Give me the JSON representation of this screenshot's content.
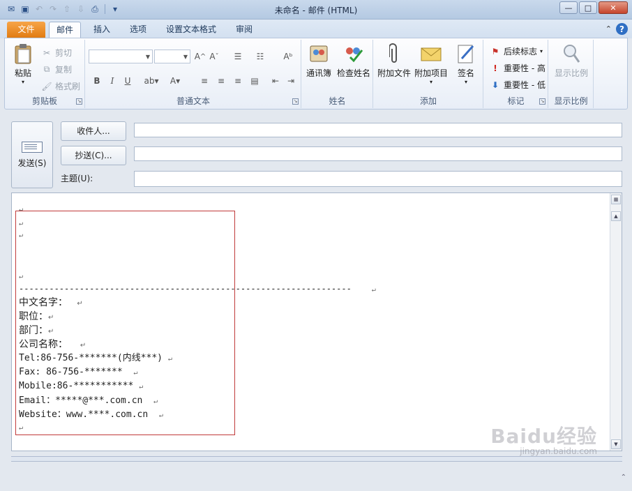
{
  "window": {
    "title": "未命名 - 邮件 (HTML)",
    "minimize": "—",
    "maximize": "□",
    "close": "✕"
  },
  "tabs": {
    "file": "文件",
    "items": [
      "邮件",
      "插入",
      "选项",
      "设置文本格式",
      "审阅"
    ],
    "active_index": 0
  },
  "ribbon": {
    "clipboard": {
      "label": "剪贴板",
      "paste": "粘贴",
      "cut": "剪切",
      "copy": "复制",
      "format_painter": "格式刷"
    },
    "basic_text": {
      "label": "普通文本",
      "bold": "B",
      "italic": "I",
      "underline": "U"
    },
    "names": {
      "label": "姓名",
      "address_book": "通讯簿",
      "check_names": "检查姓名"
    },
    "include": {
      "label": "添加",
      "attach_file": "附加文件",
      "attach_item": "附加项目",
      "signature": "签名"
    },
    "tags": {
      "label": "标记",
      "follow_up": "后续标志",
      "high_importance": "重要性 - 高",
      "low_importance": "重要性 - 低"
    },
    "zoom": {
      "label": "显示比例",
      "zoom": "显示比例"
    }
  },
  "compose": {
    "send": "发送(S)",
    "to": "收件人...",
    "cc": "抄送(C)...",
    "subject": "主题(U):",
    "to_value": "",
    "cc_value": "",
    "subject_value": ""
  },
  "body": {
    "pilcrow": "↵",
    "divider": "------------------------------------------------------------------",
    "lines": [
      "中文名字：  ",
      "职位：",
      "部门：",
      "公司名称：   ",
      "Tel:86-756-*******(内线***) ",
      "Fax: 86-756-*******  ",
      "Mobile:86-*********** ",
      "Email：*****@***.com.cn  ",
      "Website：www.****.com.cn  "
    ]
  },
  "watermark": {
    "brand": "Baidu经验",
    "url": "jingyan.baidu.com"
  },
  "colors": {
    "file_tab": "#e88a1a",
    "selection_box": "#c03a3a",
    "ribbon_bg": "#fdfdfe"
  }
}
